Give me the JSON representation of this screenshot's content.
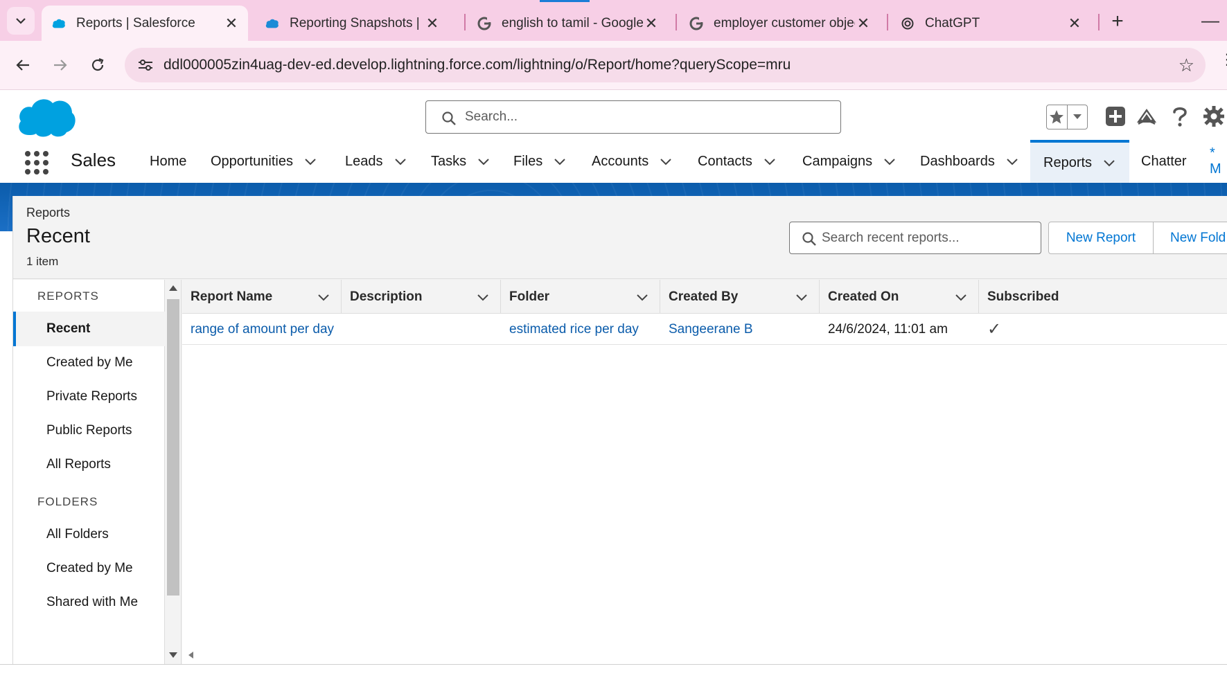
{
  "browser": {
    "tabs": [
      {
        "title": "Reports | Salesforce",
        "favicon": "salesforce-cloud-icon",
        "active": true
      },
      {
        "title": "Reporting Snapshots | Sa",
        "favicon": "salesforce-cloud-icon",
        "active": false
      },
      {
        "title": "english to tamil - Google",
        "favicon": "google-g-icon",
        "active": false
      },
      {
        "title": "employer customer objec",
        "favicon": "google-g-icon",
        "active": false
      },
      {
        "title": "ChatGPT",
        "favicon": "chatgpt-icon",
        "active": false
      }
    ],
    "close_glyph": "✕",
    "new_tab_glyph": "+",
    "minimize_glyph": "—",
    "url": "ddl000005zin4uag-dev-ed.develop.lightning.force.com/lightning/o/Report/home?queryScope=mru",
    "colors": {
      "tabstrip": "#f7cfe6",
      "toolbar": "#fdf0f7",
      "loading": "#1b7dd7"
    }
  },
  "header": {
    "search_placeholder": "Search...",
    "brand_color": "#00a1e0"
  },
  "appnav": {
    "app_name": "Sales",
    "items": [
      {
        "label": "Home",
        "has_menu": false
      },
      {
        "label": "Opportunities",
        "has_menu": true
      },
      {
        "label": "Leads",
        "has_menu": true
      },
      {
        "label": "Tasks",
        "has_menu": true
      },
      {
        "label": "Files",
        "has_menu": true
      },
      {
        "label": "Accounts",
        "has_menu": true
      },
      {
        "label": "Contacts",
        "has_menu": true
      },
      {
        "label": "Campaigns",
        "has_menu": true
      },
      {
        "label": "Dashboards",
        "has_menu": true
      },
      {
        "label": "Reports",
        "has_menu": true,
        "active": true
      },
      {
        "label": "Chatter",
        "has_menu": false
      },
      {
        "label": "* M",
        "has_menu": false
      }
    ],
    "accent": "#0176d3"
  },
  "page": {
    "breadcrumb": "Reports",
    "title": "Recent",
    "item_count": "1 item",
    "search_placeholder": "Search recent reports...",
    "new_report_label": "New Report",
    "new_folder_label": "New Fold"
  },
  "sidebar": {
    "reports_section": "REPORTS",
    "report_items": [
      "Recent",
      "Created by Me",
      "Private Reports",
      "Public Reports",
      "All Reports"
    ],
    "folders_section": "FOLDERS",
    "folder_items": [
      "All Folders",
      "Created by Me",
      "Shared with Me"
    ]
  },
  "table": {
    "columns": [
      "Report Name",
      "Description",
      "Folder",
      "Created By",
      "Created On",
      "Subscribed"
    ],
    "rows": [
      {
        "report_name": "range of amount per day",
        "description": "",
        "folder": "estimated rice per day",
        "created_by": "Sangeerane B",
        "created_on": "24/6/2024, 11:01 am",
        "subscribed_glyph": "✓"
      }
    ]
  }
}
